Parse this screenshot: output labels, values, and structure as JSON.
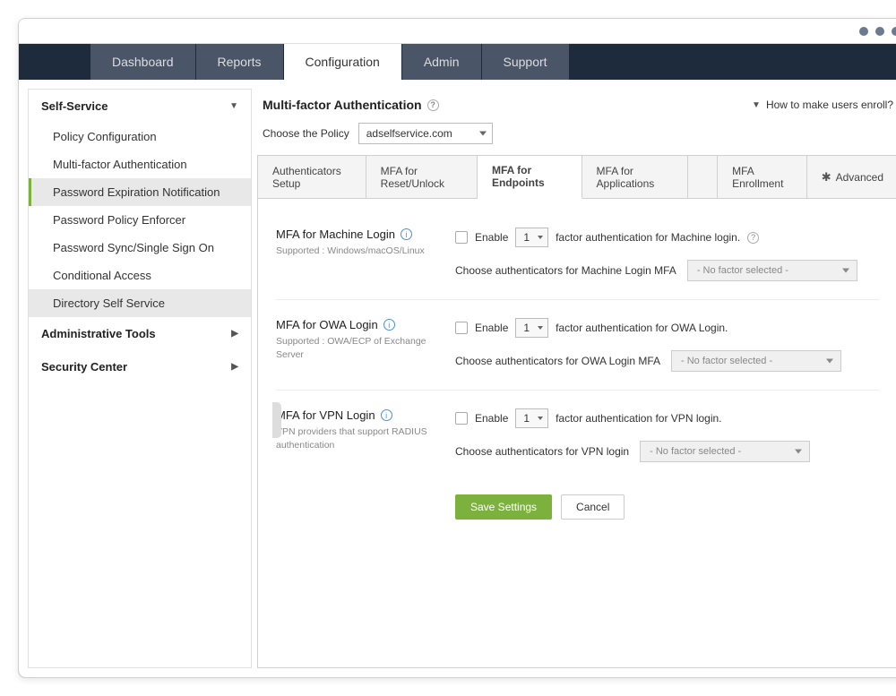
{
  "topnav": {
    "tabs": [
      {
        "label": "Dashboard"
      },
      {
        "label": "Reports"
      },
      {
        "label": "Configuration"
      },
      {
        "label": "Admin"
      },
      {
        "label": "Support"
      }
    ]
  },
  "sidebar": {
    "sections": [
      {
        "title": "Self-Service",
        "expanded": true,
        "items": [
          {
            "label": "Policy Configuration"
          },
          {
            "label": "Multi-factor Authentication"
          },
          {
            "label": "Password Expiration Notification"
          },
          {
            "label": "Password Policy Enforcer"
          },
          {
            "label": "Password Sync/Single Sign On"
          },
          {
            "label": "Conditional Access"
          },
          {
            "label": "Directory Self Service"
          }
        ]
      },
      {
        "title": "Administrative Tools",
        "expanded": false
      },
      {
        "title": "Security Center",
        "expanded": false
      }
    ]
  },
  "main": {
    "title": "Multi-factor Authentication",
    "help_link": "How to make users enroll?",
    "policy_label": "Choose the Policy",
    "policy_value": "adselfservice.com",
    "subtabs": [
      {
        "label": "Authenticators Setup"
      },
      {
        "label": "MFA for Reset/Unlock"
      },
      {
        "label": "MFA for Endpoints"
      },
      {
        "label": "MFA for Applications"
      },
      {
        "label": "MFA Enrollment"
      },
      {
        "label": "Advanced"
      }
    ],
    "blocks": [
      {
        "title": "MFA for Machine Login",
        "subtitle": "Supported : Windows/macOS/Linux",
        "enable_label": "Enable",
        "factor_value": "1",
        "enable_suffix": "factor authentication for Machine login.",
        "choose_label": "Choose authenticators for Machine Login MFA",
        "select_placeholder": "- No factor selected -"
      },
      {
        "title": "MFA for OWA Login",
        "subtitle": "Supported : OWA/ECP of Exchange Server",
        "enable_label": "Enable",
        "factor_value": "1",
        "enable_suffix": "factor authentication for OWA Login.",
        "choose_label": "Choose authenticators for OWA Login MFA",
        "select_placeholder": "- No factor selected -"
      },
      {
        "title": "MFA for VPN Login",
        "subtitle": "VPN providers that support RADIUS authentication",
        "enable_label": "Enable",
        "factor_value": "1",
        "enable_suffix": "factor authentication for VPN login.",
        "choose_label": "Choose authenticators for VPN login",
        "select_placeholder": "- No factor selected -"
      }
    ],
    "save_label": "Save Settings",
    "cancel_label": "Cancel"
  }
}
